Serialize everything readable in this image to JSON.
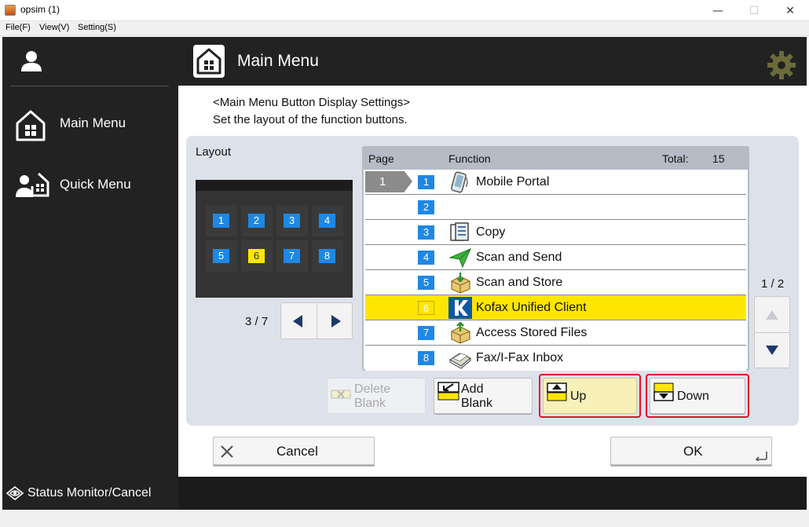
{
  "window": {
    "title": "opsim (1)",
    "minimize": "—",
    "maximize": "☐",
    "close": "✕"
  },
  "menubar": {
    "items": [
      "File(F)",
      "View(V)",
      "Setting(S)"
    ]
  },
  "sidebar": {
    "items": [
      {
        "label": "Main Menu",
        "icon": "home-icon"
      },
      {
        "label": "Quick Menu",
        "icon": "quick-menu-icon"
      }
    ],
    "status": "Status Monitor/Cancel"
  },
  "header": {
    "title": "Main Menu",
    "settings_icon": "gear-icon"
  },
  "description": {
    "line1": "<Main Menu Button Display Settings>",
    "line2": "Set the layout of the function buttons."
  },
  "layout": {
    "label": "Layout",
    "cells": [
      "1",
      "2",
      "3",
      "4",
      "5",
      "6",
      "7",
      "8"
    ],
    "selected_cell": "6",
    "page_indicator": "3 / 7"
  },
  "table": {
    "col_page": "Page",
    "col_function": "Function",
    "total_label": "Total:",
    "total_value": "15",
    "page_marker": "1",
    "rows": [
      {
        "idx": "1",
        "name": "Mobile Portal",
        "icon": "mobile-portal-icon"
      },
      {
        "idx": "2",
        "name": "",
        "icon": ""
      },
      {
        "idx": "3",
        "name": "Copy",
        "icon": "copy-icon"
      },
      {
        "idx": "4",
        "name": "Scan and Send",
        "icon": "scan-send-icon"
      },
      {
        "idx": "5",
        "name": "Scan and Store",
        "icon": "scan-store-icon"
      },
      {
        "idx": "6",
        "name": "Kofax Unified Client",
        "icon": "kofax-icon"
      },
      {
        "idx": "7",
        "name": "Access Stored Files",
        "icon": "access-files-icon"
      },
      {
        "idx": "8",
        "name": "Fax/I-Fax Inbox",
        "icon": "fax-inbox-icon"
      }
    ],
    "selected_row": "6",
    "page_label": "1 / 2"
  },
  "actions": {
    "delete_blank_line1": "Delete",
    "delete_blank_line2": "Blank",
    "add_blank_line1": "Add",
    "add_blank_line2": "Blank",
    "up": "Up",
    "down": "Down"
  },
  "footer": {
    "cancel": "Cancel",
    "ok": "OK"
  },
  "colors": {
    "accent_yellow": "#ffe600",
    "index_blue": "#1e88e5",
    "highlight_red": "#e0112b"
  }
}
